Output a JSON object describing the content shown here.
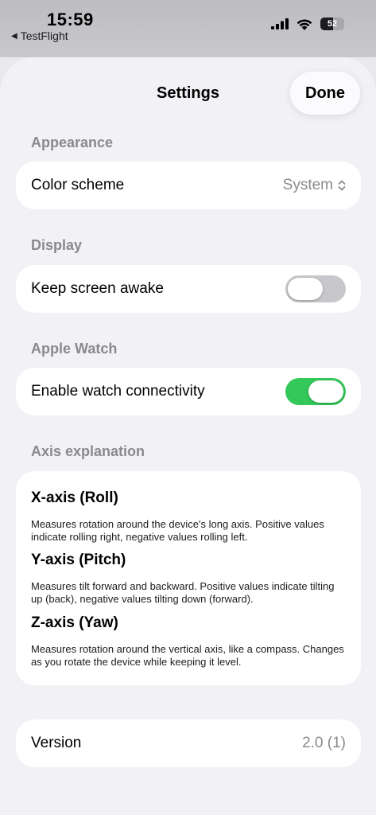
{
  "status_bar": {
    "time": "15:59",
    "back_app": "TestFlight",
    "battery": "52"
  },
  "sheet": {
    "title": "Settings",
    "done_label": "Done"
  },
  "appearance": {
    "header": "Appearance",
    "color_scheme_label": "Color scheme",
    "color_scheme_value": "System"
  },
  "display": {
    "header": "Display",
    "keep_awake_label": "Keep screen awake",
    "keep_awake_on": false
  },
  "apple_watch": {
    "header": "Apple Watch",
    "connectivity_label": "Enable watch connectivity",
    "connectivity_on": true
  },
  "axis": {
    "header": "Axis explanation",
    "items": [
      {
        "title": "X-axis (Roll)",
        "description": "Measures rotation around the device's long axis. Positive values indicate rolling right, negative values rolling left."
      },
      {
        "title": "Y-axis (Pitch)",
        "description": "Measures tilt forward and backward. Positive values indicate tilting up (back), negative values tilting down (forward)."
      },
      {
        "title": "Z-axis (Yaw)",
        "description": "Measures rotation around the vertical axis, like a compass. Changes as you rotate the device while keeping it level."
      }
    ]
  },
  "version": {
    "label": "Version",
    "value": "2.0 (1)"
  },
  "colors": {
    "toggle_on": "#34c759",
    "toggle_off": "#c8c8cc",
    "secondary_text": "#8a8a8e"
  }
}
